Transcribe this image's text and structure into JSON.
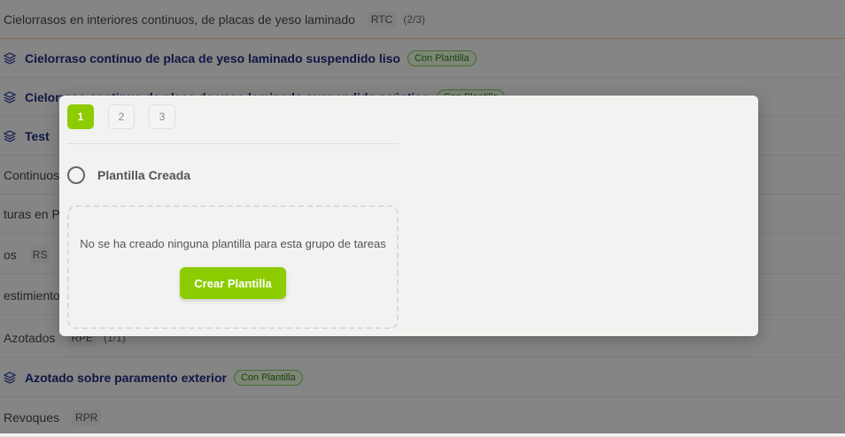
{
  "background_list": {
    "rows": [
      {
        "kind": "group",
        "title": "Cielorrasos en interiores continuos, de placas de yeso laminado",
        "code": "RTC",
        "count": "(2/3)"
      },
      {
        "kind": "item",
        "title": "Cielorraso continuo de placa de yeso laminado suspendido liso",
        "tag": "Con Plantilla"
      },
      {
        "kind": "item",
        "title": "Cielorraso continuo de placa de yeso laminado suspendido acústico",
        "tag": "Con Plantilla"
      },
      {
        "kind": "item",
        "title": "Test"
      },
      {
        "kind": "group",
        "title": "Continuos"
      },
      {
        "kind": "group",
        "title": "turas en Pa"
      },
      {
        "kind": "group",
        "title": "os",
        "code": "RS"
      },
      {
        "kind": "group",
        "title": "estimiento"
      },
      {
        "kind": "group",
        "title": "Azotados",
        "code": "RPE",
        "count": "(1/1)"
      },
      {
        "kind": "item",
        "title": "Azotado sobre paramento exterior",
        "tag": "Con Plantilla"
      },
      {
        "kind": "group",
        "title": "Revoques",
        "code": "RPR"
      }
    ]
  },
  "modal": {
    "steps": [
      "1",
      "2",
      "3"
    ],
    "active_step": "1",
    "radio_label": "Plantilla Creada",
    "empty_message": "No se ha creado ninguna plantilla para esta grupo de tareas",
    "create_button": "Crear Plantilla"
  },
  "colors": {
    "accent": "#8ccc00",
    "item_title": "#1c2b7a",
    "tag_text": "#2f7a18",
    "overlay": "rgba(0,0,0,0.45)"
  }
}
